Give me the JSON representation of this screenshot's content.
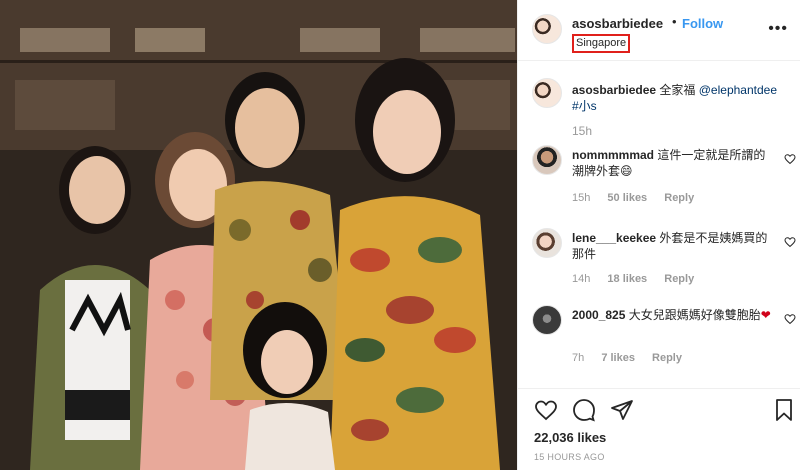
{
  "header": {
    "username": "asosbarbiedee",
    "separator": "•",
    "follow_label": "Follow",
    "location": "Singapore",
    "more_icon": "more-horizontal-icon"
  },
  "caption": {
    "username": "asosbarbiedee",
    "text": "全家福",
    "mention": "@elephantdee",
    "hashtag": "#小s",
    "time": "15h"
  },
  "comments": [
    {
      "username": "nommmmmad",
      "text": "這件一定就是所謂的潮牌外套😄",
      "time": "15h",
      "likes": "50 likes",
      "reply": "Reply"
    },
    {
      "username": "lene___keekee",
      "text": "外套是不是姨媽買的那件",
      "time": "14h",
      "likes": "18 likes",
      "reply": "Reply"
    },
    {
      "username": "2000_825",
      "text": "大女兒跟媽媽好像雙胞胎",
      "emoji": "❤",
      "time": "7h",
      "likes": "7 likes",
      "reply": "Reply"
    }
  ],
  "actions": {
    "icons": [
      "heart-icon",
      "comment-icon",
      "share-icon",
      "bookmark-icon"
    ]
  },
  "likes_total": "22,036 likes",
  "post_time": "15 HOURS AGO",
  "colors": {
    "link": "#003569",
    "follow": "#3897f0",
    "highlight_box": "#e0201b",
    "muted": "#999999"
  }
}
